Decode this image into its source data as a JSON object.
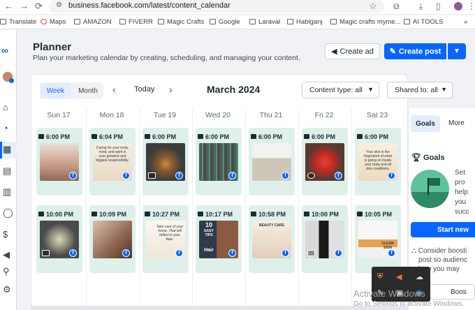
{
  "browser": {
    "url": "business.facebook.com/latest/content_calendar",
    "bookmarks": [
      "Translate",
      "Maps",
      "AMAZON",
      "FIVERR",
      "Magic Crafts",
      "Google",
      "Laraval",
      "Habiganj",
      "Magic crafts myme...",
      "AI TOOLS"
    ]
  },
  "header": {
    "title": "Planner",
    "subtitle": "Plan your marketing calendar by creating, scheduling, and managing your content.",
    "create_ad": "Create ad",
    "create_post": "Create post"
  },
  "calendar": {
    "view_week": "Week",
    "view_month": "Month",
    "today": "Today",
    "month_label": "March 2024",
    "content_type": "Content type: all",
    "shared_to": "Shared to: all",
    "days": [
      "Sun 17",
      "Mon 18",
      "Tue 19",
      "Wed 20",
      "Thu 21",
      "Fri 22",
      "Sat 23"
    ],
    "row1_times": [
      "6:00 PM",
      "6:04 PM",
      "6:00 PM",
      "6:00 PM",
      "6:00 PM",
      "6:00 PM",
      "6:00 PM"
    ],
    "row2_times": [
      "10:00 PM",
      "10:09 PM",
      "10:27 PM",
      "10:17 PM",
      "10:58 PM",
      "10:00 PM",
      "10:05 PM"
    ],
    "thumb_text": {
      "t2": "Caring for your body, mind, and spirit is your greatest and biggest responsibility.",
      "t7": "Your skin is the fingerprint of what is going on inside your body and all skin conditions.",
      "t10": "Take care of your home. That will reflect in your face.",
      "t11a": "10",
      "t11b": "EASY TIPS",
      "t11c": "Hair",
      "t12": "BEAUTY CARE",
      "t14": "CLEAN SKIN"
    }
  },
  "side": {
    "tab_goals": "Goals",
    "tab_more": "More",
    "goals_title": "Goals",
    "goals_desc": [
      "Set",
      "pro",
      "help",
      "you",
      "succ"
    ],
    "start_btn": "Start new",
    "boost_lines": [
      "Consider boosti",
      "post so audienc",
      "how you may"
    ],
    "boost_btn": "Boos"
  },
  "overlay": {
    "activate_title": "Activate Windows",
    "activate_sub": "Go to Settings to activate Windows."
  },
  "colors": {
    "accent": "#0866ff",
    "card_bg": "#dff0ea"
  }
}
